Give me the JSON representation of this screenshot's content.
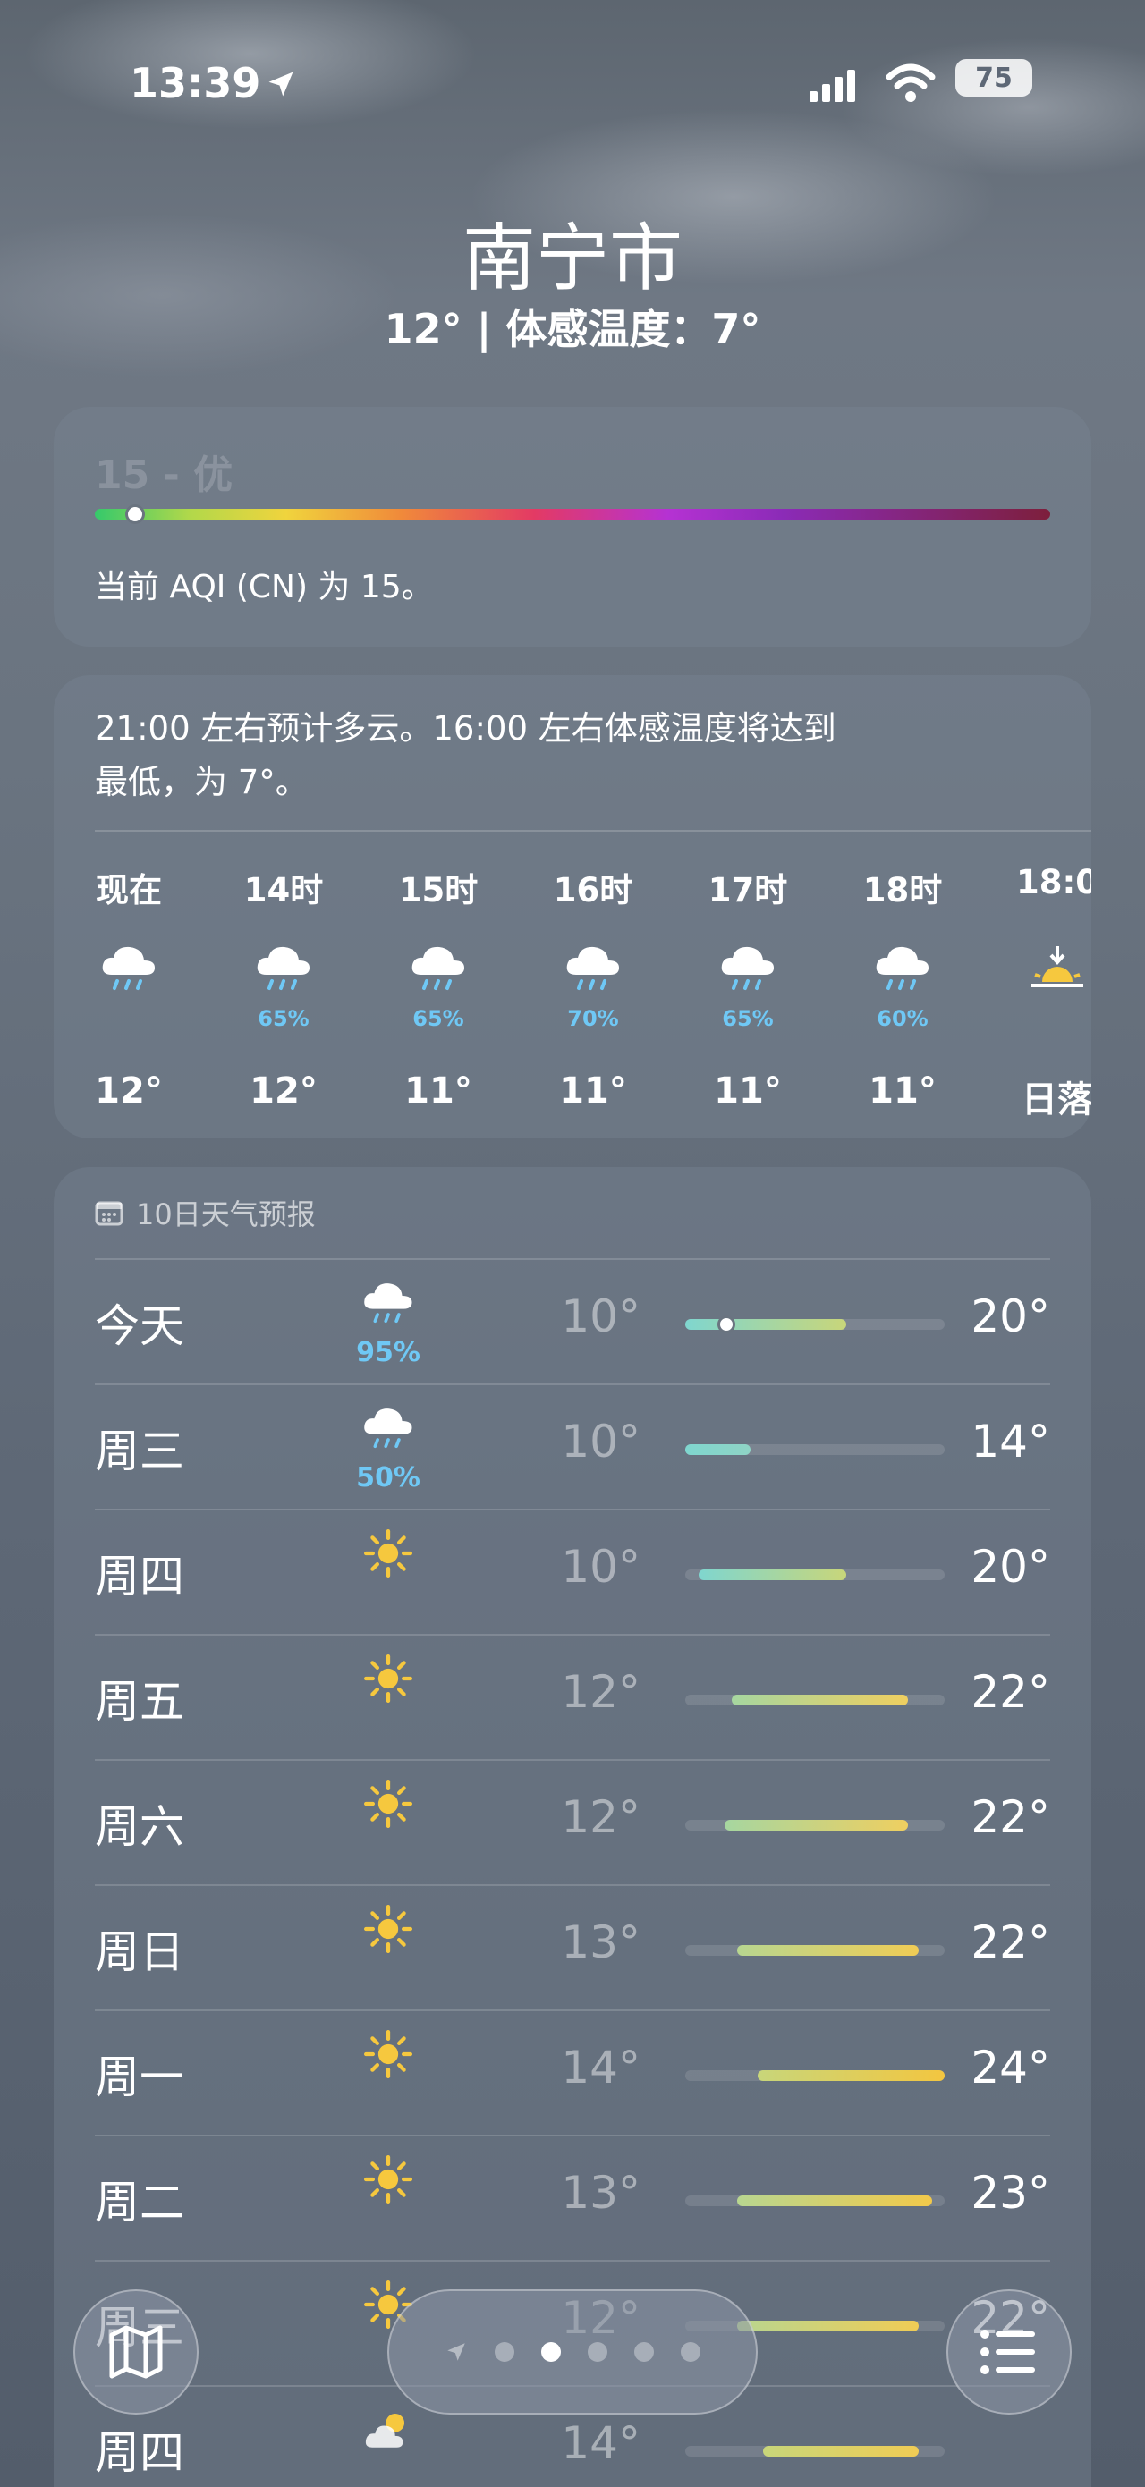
{
  "status": {
    "time": "13:39",
    "battery": "75"
  },
  "header": {
    "city": "南宁市",
    "subtitle": "12° | 体感温度：7°"
  },
  "aqi": {
    "title": "15 - 优",
    "description": "当前 AQI (CN) 为 15。"
  },
  "hourly": {
    "summary_line1": "21:00 左右预计多云。16:00 左右体感温度将达到",
    "summary_line2": "最低，为 7°。",
    "items": [
      {
        "label": "现在",
        "pct": "",
        "temp": "12°",
        "icon": "cloud-rain-icon"
      },
      {
        "label": "14时",
        "pct": "65%",
        "temp": "12°",
        "icon": "cloud-rain-icon"
      },
      {
        "label": "15时",
        "pct": "65%",
        "temp": "11°",
        "icon": "cloud-rain-icon"
      },
      {
        "label": "16时",
        "pct": "70%",
        "temp": "11°",
        "icon": "cloud-rain-icon"
      },
      {
        "label": "17时",
        "pct": "65%",
        "temp": "11°",
        "icon": "cloud-rain-icon"
      },
      {
        "label": "18时",
        "pct": "60%",
        "temp": "11°",
        "icon": "cloud-rain-icon"
      },
      {
        "label": "18:0",
        "pct": "",
        "temp": "日落",
        "icon": "sunset-icon"
      }
    ]
  },
  "daily": {
    "heading": "10日天气预报",
    "days": [
      {
        "name": "今天",
        "icon": "cloud-rain-icon",
        "pct": "95%",
        "lo": "10°",
        "hi": "20°",
        "from": 0.0,
        "to": 0.62,
        "c1": "#7fd6cf",
        "c2": "#c8d67a"
      },
      {
        "name": "周三",
        "icon": "cloud-rain-icon",
        "pct": "50%",
        "lo": "10°",
        "hi": "14°",
        "from": 0.0,
        "to": 0.25,
        "c1": "#7fd6cf",
        "c2": "#8fd4c5"
      },
      {
        "name": "周四",
        "icon": "sun-icon",
        "pct": "",
        "lo": "10°",
        "hi": "20°",
        "from": 0.05,
        "to": 0.62,
        "c1": "#7fd6cf",
        "c2": "#c8d67a"
      },
      {
        "name": "周五",
        "icon": "sun-icon",
        "pct": "",
        "lo": "12°",
        "hi": "22°",
        "from": 0.18,
        "to": 0.86,
        "c1": "#a6d6a0",
        "c2": "#efcf60"
      },
      {
        "name": "周六",
        "icon": "sun-icon",
        "pct": "",
        "lo": "12°",
        "hi": "22°",
        "from": 0.15,
        "to": 0.86,
        "c1": "#a6d6a0",
        "c2": "#efcf60"
      },
      {
        "name": "周日",
        "icon": "sun-icon",
        "pct": "",
        "lo": "13°",
        "hi": "22°",
        "from": 0.2,
        "to": 0.9,
        "c1": "#b8d690",
        "c2": "#f0cc55"
      },
      {
        "name": "周一",
        "icon": "sun-icon",
        "pct": "",
        "lo": "14°",
        "hi": "24°",
        "from": 0.28,
        "to": 1.0,
        "c1": "#c8d67a",
        "c2": "#f3c640"
      },
      {
        "name": "周二",
        "icon": "sun-icon",
        "pct": "",
        "lo": "13°",
        "hi": "23°",
        "from": 0.2,
        "to": 0.95,
        "c1": "#b8d690",
        "c2": "#f2c94a"
      },
      {
        "name": "周三",
        "icon": "sun-icon",
        "pct": "",
        "lo": "12°",
        "hi": "22°",
        "from": 0.2,
        "to": 0.9,
        "c1": "#b8d690",
        "c2": "#f0cc55"
      },
      {
        "name": "周四",
        "icon": "cloud-sun-icon",
        "pct": "",
        "lo": "14°",
        "hi": "",
        "from": 0.3,
        "to": 0.9,
        "c1": "#c8d67a",
        "c2": "#f0cc55"
      }
    ]
  },
  "pager": {
    "pages": 5,
    "active": 1
  }
}
